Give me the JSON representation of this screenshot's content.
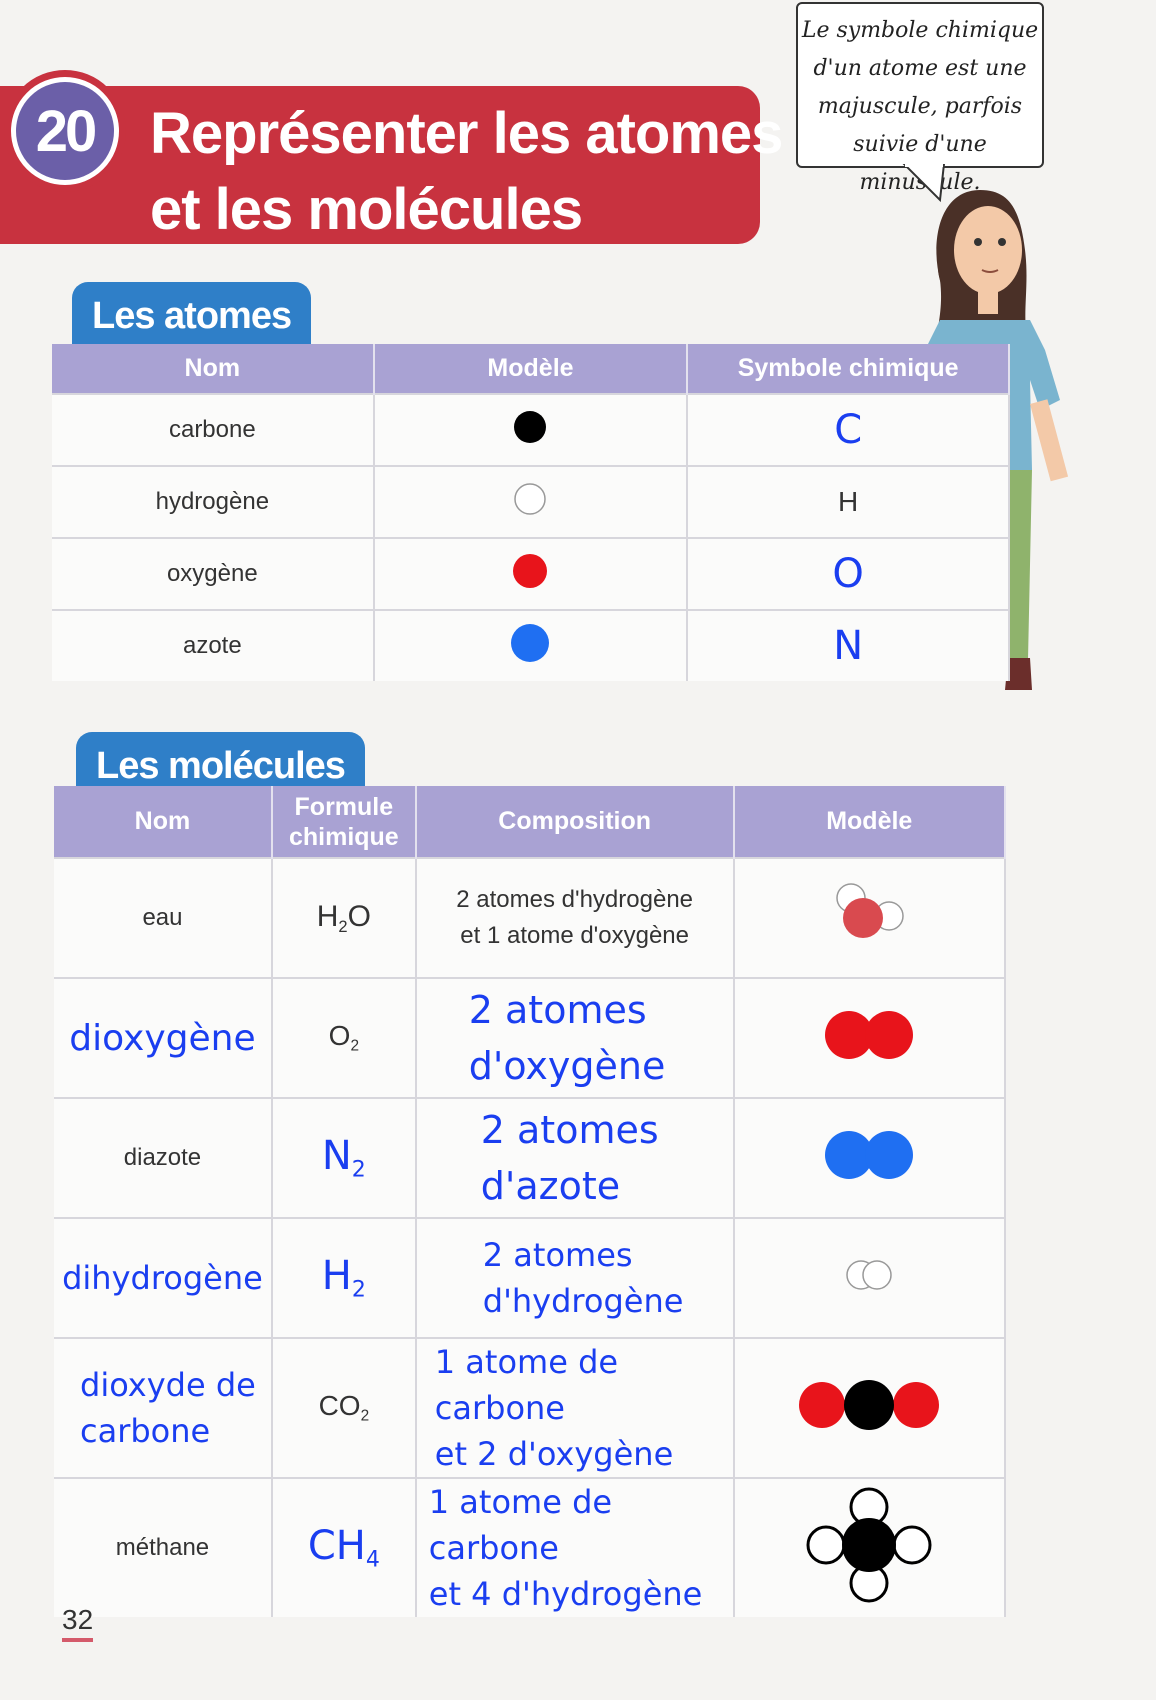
{
  "chapter": {
    "number": "20",
    "title_line1": "Représenter les atomes",
    "title_line2": "et les molécules"
  },
  "bubble": {
    "line1": "Le symbole chimique",
    "line2": "d'un atome est une",
    "line3": "majuscule, parfois",
    "line4": "suivie d'une minuscule."
  },
  "atoms": {
    "tab": "Les atomes",
    "headers": [
      "Nom",
      "Modèle",
      "Symbole chimique"
    ],
    "rows": [
      {
        "name": "carbone",
        "color": "#000000",
        "symbol": "C"
      },
      {
        "name": "hydrogène",
        "color": "#ffffff",
        "symbol": "H"
      },
      {
        "name": "oxygène",
        "color": "#e8141b",
        "symbol": "O"
      },
      {
        "name": "azote",
        "color": "#1f6ff2",
        "symbol": "N"
      }
    ]
  },
  "molecules": {
    "tab": "Les molécules",
    "headers": [
      "Nom",
      "Formule chimique",
      "Composition",
      "Modèle"
    ],
    "formula_header_line1": "Formule",
    "formula_header_line2": "chimique",
    "rows": [
      {
        "name": "eau",
        "formula_main": "H",
        "formula_sub": "2",
        "formula_tail": "O",
        "comp1": "2 atomes d'hydrogène",
        "comp2": "et 1 atome d'oxygène",
        "model": "water"
      },
      {
        "name": "dioxygène",
        "formula_main": "O",
        "formula_sub": "2",
        "formula_tail": "",
        "comp1": "2 atomes",
        "comp2": "d'oxygène",
        "model": "O2"
      },
      {
        "name": "diazote",
        "formula_main": "N",
        "formula_sub": "2",
        "formula_tail": "",
        "comp1": "2 atomes",
        "comp2": "d'azote",
        "model": "N2"
      },
      {
        "name": "dihydrogène",
        "formula_main": "H",
        "formula_sub": "2",
        "formula_tail": "",
        "comp1": "2 atomes",
        "comp2": "d'hydrogène",
        "model": "H2"
      },
      {
        "name1": "dioxyde de",
        "name2": "carbone",
        "formula_main": "CO",
        "formula_sub": "2",
        "formula_tail": "",
        "comp1": "1 atome de carbone",
        "comp2": "et 2 d'oxygène",
        "model": "CO2"
      },
      {
        "name": "méthane",
        "formula_main": "CH",
        "formula_sub": "4",
        "formula_tail": "",
        "comp1": "1 atome de carbone",
        "comp2": "et 4 d'hydrogène",
        "model": "CH4"
      }
    ]
  },
  "page_number": "32"
}
